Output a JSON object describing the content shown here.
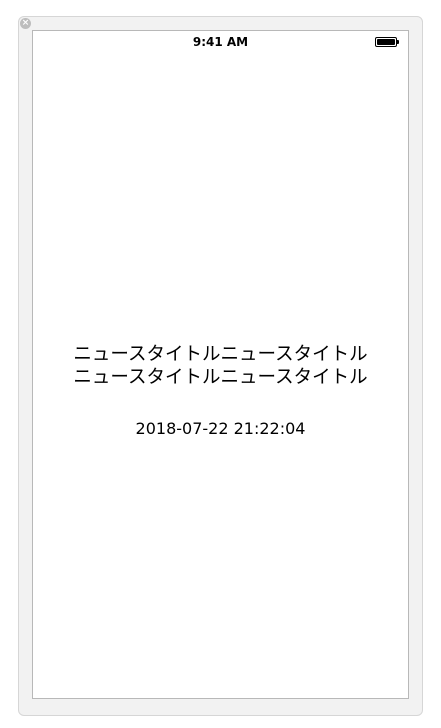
{
  "window": {
    "close_icon": "close-icon",
    "close_glyph": "×"
  },
  "status_bar": {
    "time": "9:41 AM",
    "battery_icon": "battery-icon"
  },
  "content": {
    "title": "ニュースタイトルニュースタイトル\nニュースタイトルニュースタイトル",
    "date": "2018-07-22 21:22:04"
  }
}
